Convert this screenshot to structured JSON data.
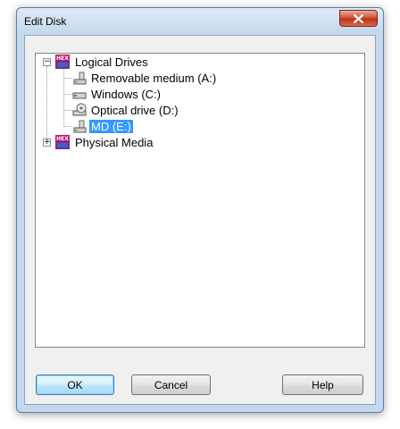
{
  "window": {
    "title": "Edit Disk"
  },
  "tree": {
    "root": {
      "label": "Logical Drives",
      "expander": "−",
      "icon": "hex-workshop-icon"
    },
    "children": [
      {
        "label": "Removable medium (A:)",
        "icon": "removable-drive-icon"
      },
      {
        "label": "Windows (C:)",
        "icon": "hard-drive-icon"
      },
      {
        "label": "Optical drive (D:)",
        "icon": "optical-drive-icon"
      },
      {
        "label": "MD (E:)",
        "icon": "removable-drive-icon",
        "selected": true
      }
    ],
    "second": {
      "label": "Physical Media",
      "expander": "+",
      "icon": "hex-workshop-icon"
    }
  },
  "buttons": {
    "ok": "OK",
    "cancel": "Cancel",
    "help": "Help"
  },
  "colors": {
    "selection": "#3399ff",
    "close_button": "#c0311b"
  }
}
